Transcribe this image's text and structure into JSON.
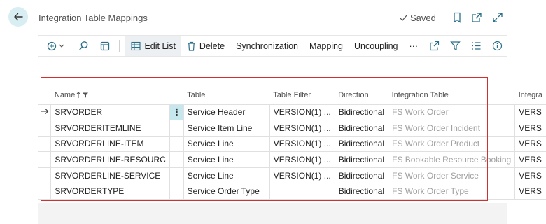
{
  "header": {
    "title": "Integration Table Mappings",
    "saved_label": "Saved"
  },
  "toolbar": {
    "edit_list": "Edit List",
    "delete": "Delete",
    "synchronization": "Synchronization",
    "mapping": "Mapping",
    "uncoupling": "Uncoupling",
    "more": "···"
  },
  "grid": {
    "columns": {
      "name": "Name",
      "table": "Table",
      "table_filter": "Table Filter",
      "direction": "Direction",
      "integration_table": "Integration Table",
      "integration_table_filter": "Integra"
    },
    "rows": [
      {
        "name": "SRVORDER",
        "table": "Service Header",
        "table_filter": "VERSION(1) ...",
        "direction": "Bidirectional",
        "integration_table": "FS Work Order",
        "integration_filter": "VERS"
      },
      {
        "name": "SRVORDERITEMLINE",
        "table": "Service Item Line",
        "table_filter": "VERSION(1) ...",
        "direction": "Bidirectional",
        "integration_table": "FS Work Order Incident",
        "integration_filter": "VERS"
      },
      {
        "name": "SRVORDERLINE-ITEM",
        "table": "Service Line",
        "table_filter": "VERSION(1) ...",
        "direction": "Bidirectional",
        "integration_table": "FS Work Order Product",
        "integration_filter": "VERS"
      },
      {
        "name": "SRVORDERLINE-RESOURC",
        "table": "Service Line",
        "table_filter": "VERSION(1) ...",
        "direction": "Bidirectional",
        "integration_table": "FS Bookable Resource Booking",
        "integration_filter": "VERS"
      },
      {
        "name": "SRVORDERLINE-SERVICE",
        "table": "Service Line",
        "table_filter": "VERSION(1) ...",
        "direction": "Bidirectional",
        "integration_table": "FS Work Order Service",
        "integration_filter": "VERS"
      },
      {
        "name": "SRVORDERTYPE",
        "table": "Service Order Type",
        "table_filter": "",
        "direction": "Bidirectional",
        "integration_table": "FS Work Order Type",
        "integration_filter": "VERS"
      }
    ]
  },
  "colors": {
    "accent": "#c7e7ee",
    "highlight_border": "#d32f2f",
    "muted_text": "#a0a0a0"
  }
}
